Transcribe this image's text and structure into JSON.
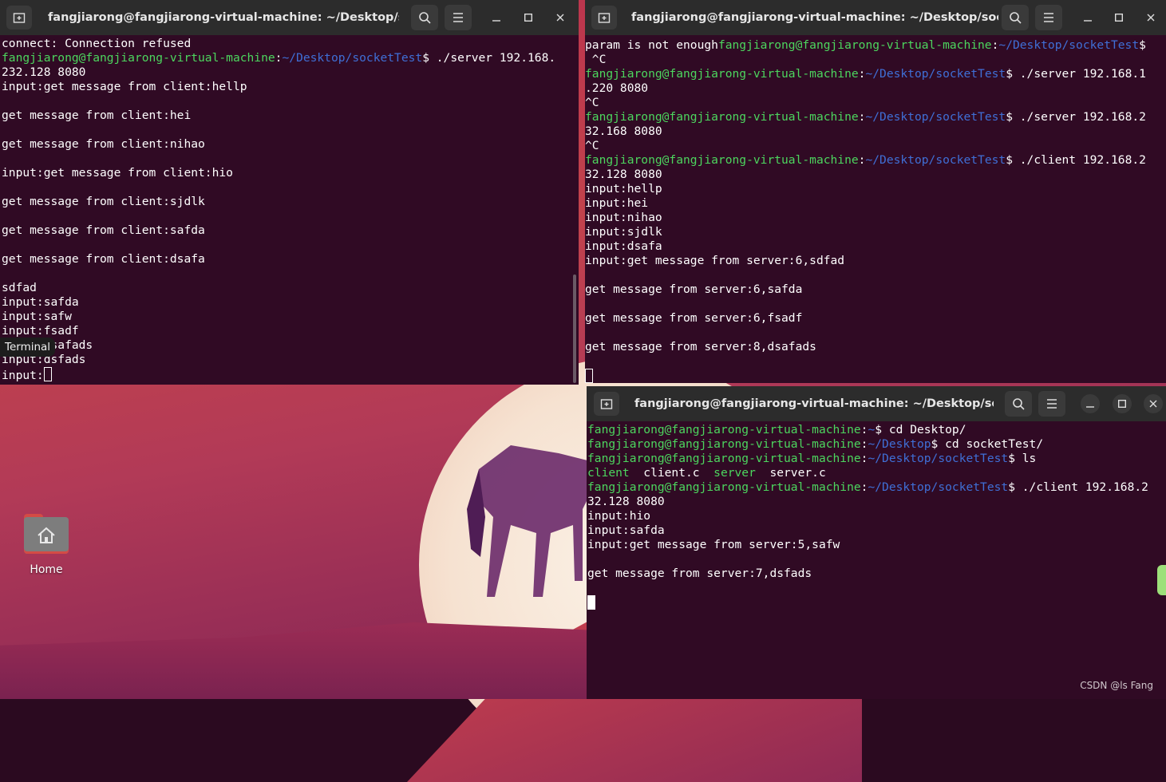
{
  "desktop": {
    "home_label": "Home",
    "watermark": "CSDN @ls Fang",
    "tooltip": "Terminal"
  },
  "term1": {
    "title": "fangjiarong@fangjiarong-virtual-machine: ~/Desktop/socke...",
    "lines": [
      [
        {
          "t": "connect: Connection refused"
        }
      ],
      [
        {
          "t": "fangjiarong@fangjiarong-virtual-machine",
          "c": "g"
        },
        {
          "t": ":"
        },
        {
          "t": "~/Desktop/socketTest",
          "c": "b"
        },
        {
          "t": "$ ./server 192.168."
        }
      ],
      [
        {
          "t": "232.128 8080"
        }
      ],
      [
        {
          "t": "input:get message from client:hellp"
        }
      ],
      [
        {
          "t": ""
        }
      ],
      [
        {
          "t": "get message from client:hei"
        }
      ],
      [
        {
          "t": ""
        }
      ],
      [
        {
          "t": "get message from client:nihao"
        }
      ],
      [
        {
          "t": ""
        }
      ],
      [
        {
          "t": "input:get message from client:hio"
        }
      ],
      [
        {
          "t": ""
        }
      ],
      [
        {
          "t": "get message from client:sjdlk"
        }
      ],
      [
        {
          "t": ""
        }
      ],
      [
        {
          "t": "get message from client:safda"
        }
      ],
      [
        {
          "t": ""
        }
      ],
      [
        {
          "t": "get message from client:dsafa"
        }
      ],
      [
        {
          "t": ""
        }
      ],
      [
        {
          "t": "sdfad"
        }
      ],
      [
        {
          "t": "input:safda"
        }
      ],
      [
        {
          "t": "input:safw"
        }
      ],
      [
        {
          "t": "input:fsadf"
        }
      ],
      [
        {
          "t": "input:dsafads"
        }
      ],
      [
        {
          "t": "input:dsfads"
        }
      ],
      [
        {
          "t": "input:"
        },
        {
          "cursor": "outline"
        }
      ]
    ]
  },
  "term2": {
    "title": "fangjiarong@fangjiarong-virtual-machine: ~/Desktop/socket...",
    "lines": [
      [
        {
          "t": "param is not enough"
        },
        {
          "t": "fangjiarong@fangjiarong-virtual-machine",
          "c": "g"
        },
        {
          "t": ":"
        },
        {
          "t": "~/Desktop/socketTest",
          "c": "b"
        },
        {
          "t": "$"
        }
      ],
      [
        {
          "t": " ^C"
        }
      ],
      [
        {
          "t": "fangjiarong@fangjiarong-virtual-machine",
          "c": "g"
        },
        {
          "t": ":"
        },
        {
          "t": "~/Desktop/socketTest",
          "c": "b"
        },
        {
          "t": "$ ./server 192.168.1"
        }
      ],
      [
        {
          "t": ".220 8080"
        }
      ],
      [
        {
          "t": "^C"
        }
      ],
      [
        {
          "t": "fangjiarong@fangjiarong-virtual-machine",
          "c": "g"
        },
        {
          "t": ":"
        },
        {
          "t": "~/Desktop/socketTest",
          "c": "b"
        },
        {
          "t": "$ ./server 192.168.2"
        }
      ],
      [
        {
          "t": "32.168 8080"
        }
      ],
      [
        {
          "t": "^C"
        }
      ],
      [
        {
          "t": "fangjiarong@fangjiarong-virtual-machine",
          "c": "g"
        },
        {
          "t": ":"
        },
        {
          "t": "~/Desktop/socketTest",
          "c": "b"
        },
        {
          "t": "$ ./client 192.168.2"
        }
      ],
      [
        {
          "t": "32.128 8080"
        }
      ],
      [
        {
          "t": "input:hellp"
        }
      ],
      [
        {
          "t": "input:hei"
        }
      ],
      [
        {
          "t": "input:nihao"
        }
      ],
      [
        {
          "t": "input:sjdlk"
        }
      ],
      [
        {
          "t": "input:dsafa"
        }
      ],
      [
        {
          "t": "input:get message from server:6,sdfad"
        }
      ],
      [
        {
          "t": ""
        }
      ],
      [
        {
          "t": "get message from server:6,safda"
        }
      ],
      [
        {
          "t": ""
        }
      ],
      [
        {
          "t": "get message from server:6,fsadf"
        }
      ],
      [
        {
          "t": ""
        }
      ],
      [
        {
          "t": "get message from server:8,dsafads"
        }
      ],
      [
        {
          "t": ""
        }
      ],
      [
        {
          "cursor": "outline"
        }
      ]
    ]
  },
  "term3": {
    "title": "fangjiarong@fangjiarong-virtual-machine: ~/Desktop/socket...",
    "lines": [
      [
        {
          "t": "fangjiarong@fangjiarong-virtual-machine",
          "c": "g"
        },
        {
          "t": ":"
        },
        {
          "t": "~",
          "c": "b"
        },
        {
          "t": "$ cd Desktop/"
        }
      ],
      [
        {
          "t": "fangjiarong@fangjiarong-virtual-machine",
          "c": "g"
        },
        {
          "t": ":"
        },
        {
          "t": "~/Desktop",
          "c": "b"
        },
        {
          "t": "$ cd socketTest/"
        }
      ],
      [
        {
          "t": "fangjiarong@fangjiarong-virtual-machine",
          "c": "g"
        },
        {
          "t": ":"
        },
        {
          "t": "~/Desktop/socketTest",
          "c": "b"
        },
        {
          "t": "$ ls"
        }
      ],
      [
        {
          "t": "client",
          "c": "g"
        },
        {
          "t": "  client.c  "
        },
        {
          "t": "server",
          "c": "g"
        },
        {
          "t": "  server.c"
        }
      ],
      [
        {
          "t": "fangjiarong@fangjiarong-virtual-machine",
          "c": "g"
        },
        {
          "t": ":"
        },
        {
          "t": "~/Desktop/socketTest",
          "c": "b"
        },
        {
          "t": "$ ./client 192.168.2"
        }
      ],
      [
        {
          "t": "32.128 8080"
        }
      ],
      [
        {
          "t": "input:hio"
        }
      ],
      [
        {
          "t": "input:safda"
        }
      ],
      [
        {
          "t": "input:get message from server:5,safw"
        }
      ],
      [
        {
          "t": ""
        }
      ],
      [
        {
          "t": "get message from server:7,dsfads"
        }
      ],
      [
        {
          "t": ""
        }
      ],
      [
        {
          "cursor": "solid"
        }
      ]
    ]
  }
}
